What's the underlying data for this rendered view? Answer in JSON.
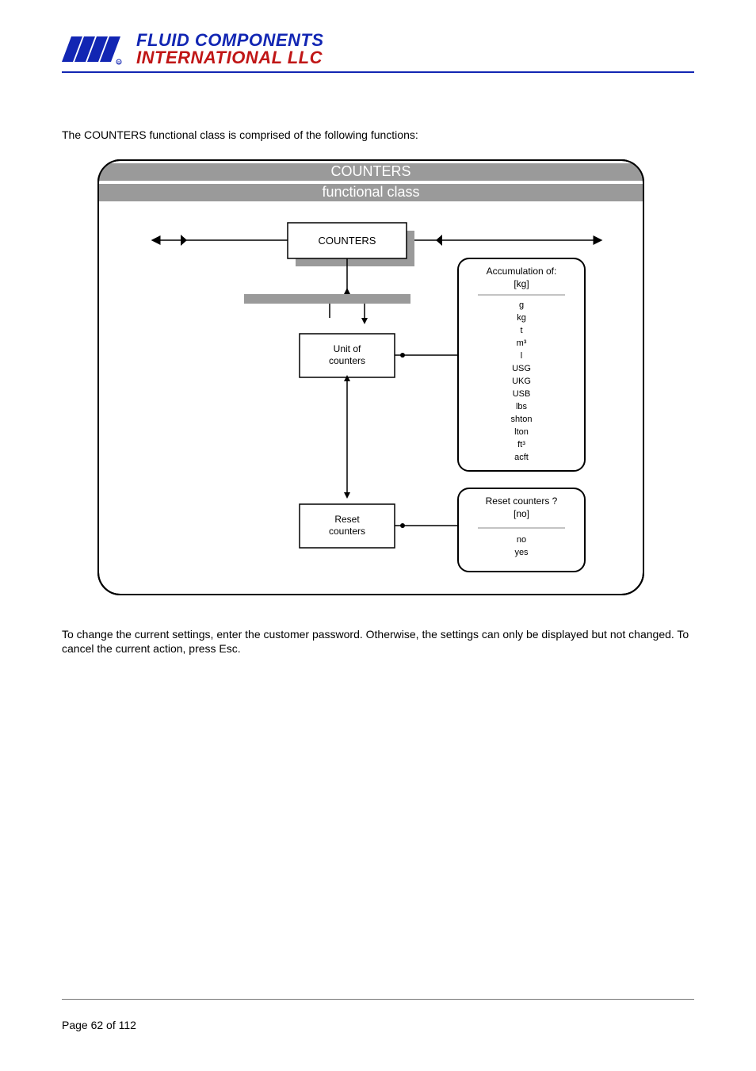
{
  "header": {
    "logo_top": "FLUID COMPONENTS",
    "logo_bottom": "INTERNATIONAL LLC",
    "logo_mark": "FCI"
  },
  "intro_text": "The COUNTERS functional class is comprised of the following functions:",
  "diagram": {
    "title_line1": "COUNTERS",
    "title_line2": "functional class",
    "node_counters": "COUNTERS",
    "node_unit_line1": "Unit of",
    "node_unit_line2": "counters",
    "node_reset_line1": "Reset",
    "node_reset_line2": "counters",
    "accum_title": "Accumulation of:",
    "accum_current": "[kg]",
    "accum_options": [
      "g",
      "kg",
      "t",
      "m³",
      "l",
      "USG",
      "UKG",
      "USB",
      "lbs",
      "shton",
      "lton",
      "ft³",
      "acft"
    ],
    "reset_title": "Reset counters ?",
    "reset_current": "[no]",
    "reset_options": [
      "no",
      "yes"
    ]
  },
  "outro_text": "To change the current settings, enter the customer password. Otherwise, the settings can only be displayed but not changed. To cancel the current action, press Esc.",
  "footer": {
    "page_label": "Page 62 of 112"
  }
}
